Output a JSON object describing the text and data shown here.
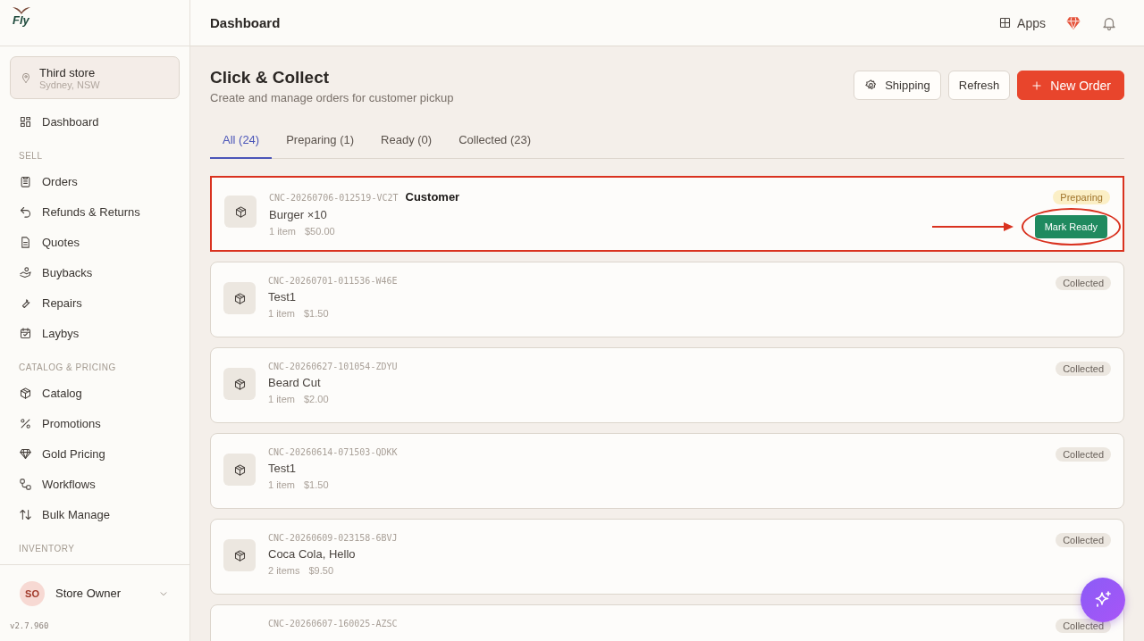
{
  "brand": {
    "logo_text": "Fly"
  },
  "store": {
    "name": "Third store",
    "location": "Sydney, NSW"
  },
  "sidebar": {
    "items": [
      {
        "kind": "item",
        "label": "Dashboard"
      },
      {
        "kind": "section",
        "label": "SELL"
      },
      {
        "kind": "item",
        "label": "Orders"
      },
      {
        "kind": "item",
        "label": "Refunds & Returns"
      },
      {
        "kind": "item",
        "label": "Quotes"
      },
      {
        "kind": "item",
        "label": "Buybacks"
      },
      {
        "kind": "item",
        "label": "Repairs"
      },
      {
        "kind": "item",
        "label": "Laybys"
      },
      {
        "kind": "section",
        "label": "CATALOG & PRICING"
      },
      {
        "kind": "item",
        "label": "Catalog"
      },
      {
        "kind": "item",
        "label": "Promotions"
      },
      {
        "kind": "item",
        "label": "Gold Pricing"
      },
      {
        "kind": "item",
        "label": "Workflows"
      },
      {
        "kind": "item",
        "label": "Bulk Manage"
      },
      {
        "kind": "section",
        "label": "INVENTORY"
      }
    ],
    "user": {
      "initials": "SO",
      "name": "Store Owner"
    },
    "version": "v2.7.960"
  },
  "topbar": {
    "title": "Dashboard",
    "apps_label": "Apps"
  },
  "page": {
    "title": "Click & Collect",
    "subtitle": "Create and manage orders for customer pickup",
    "buttons": [
      {
        "kind": "settings",
        "label": "Shipping"
      },
      {
        "kind": "plain",
        "label": "Refresh"
      },
      {
        "kind": "primary",
        "label": "New Order"
      }
    ]
  },
  "tabs": [
    {
      "label": "All (24)",
      "selected": true
    },
    {
      "label": "Preparing (1)",
      "selected": false
    },
    {
      "label": "Ready (0)",
      "selected": false
    },
    {
      "label": "Collected (23)",
      "selected": false
    }
  ],
  "orders": [
    {
      "id": "CNC-20260706-012519-VC2T",
      "customer": "Customer",
      "name": "Burger ×10",
      "count": "1 item",
      "total": "$50.00",
      "status": "Preparing",
      "kind": "preparing",
      "action": "Mark Ready",
      "highlighted": true
    },
    {
      "id": "CNC-20260701-011536-W46E",
      "name": "Test1",
      "count": "1 item",
      "total": "$1.50",
      "status": "Collected",
      "kind": "collected",
      "highlighted": false
    },
    {
      "id": "CNC-20260627-101054-ZDYU",
      "name": "Beard Cut",
      "count": "1 item",
      "total": "$2.00",
      "status": "Collected",
      "kind": "collected",
      "highlighted": false
    },
    {
      "id": "CNC-20260614-071503-QDKK",
      "name": "Test1",
      "count": "1 item",
      "total": "$1.50",
      "status": "Collected",
      "kind": "collected",
      "highlighted": false
    },
    {
      "id": "CNC-20260609-023158-6BVJ",
      "name": "Coca Cola, Hello",
      "count": "2 items",
      "total": "$9.50",
      "status": "Collected",
      "kind": "collected",
      "highlighted": false
    },
    {
      "id": "CNC-20260607-160025-AZSC",
      "status": "Collected",
      "kind": "collected",
      "highlighted": false
    }
  ]
}
